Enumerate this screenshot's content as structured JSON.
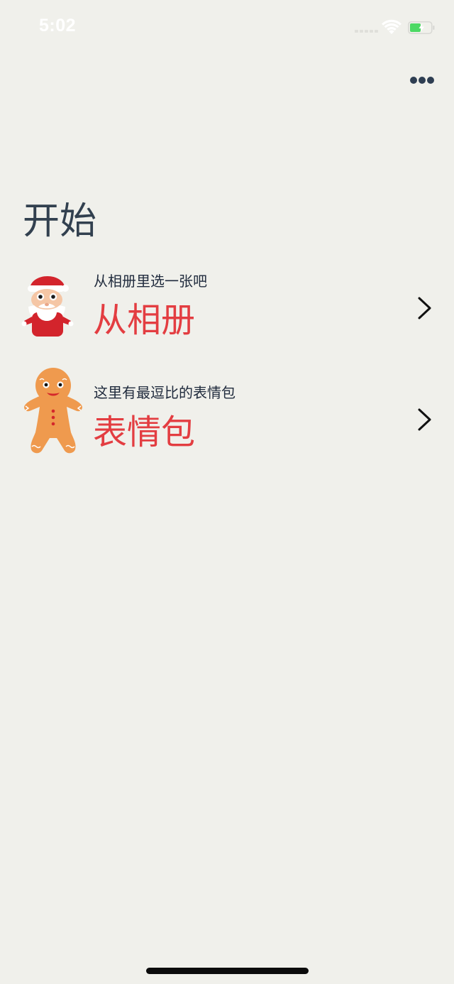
{
  "status_bar": {
    "time": "5:02",
    "battery_color": "#4cd964"
  },
  "header": {
    "more_icon": "more-icon"
  },
  "page": {
    "title": "开始"
  },
  "entries": [
    {
      "icon": "santa-icon",
      "subtitle": "从相册里选一张吧",
      "title": "从相册"
    },
    {
      "icon": "gingerbread-icon",
      "subtitle": "这里有最逗比的表情包",
      "title": "表情包"
    }
  ],
  "colors": {
    "background": "#f0f0eb",
    "accent": "#e33d41",
    "title_text": "#32404f",
    "subtitle_text": "#1f2a3c"
  }
}
